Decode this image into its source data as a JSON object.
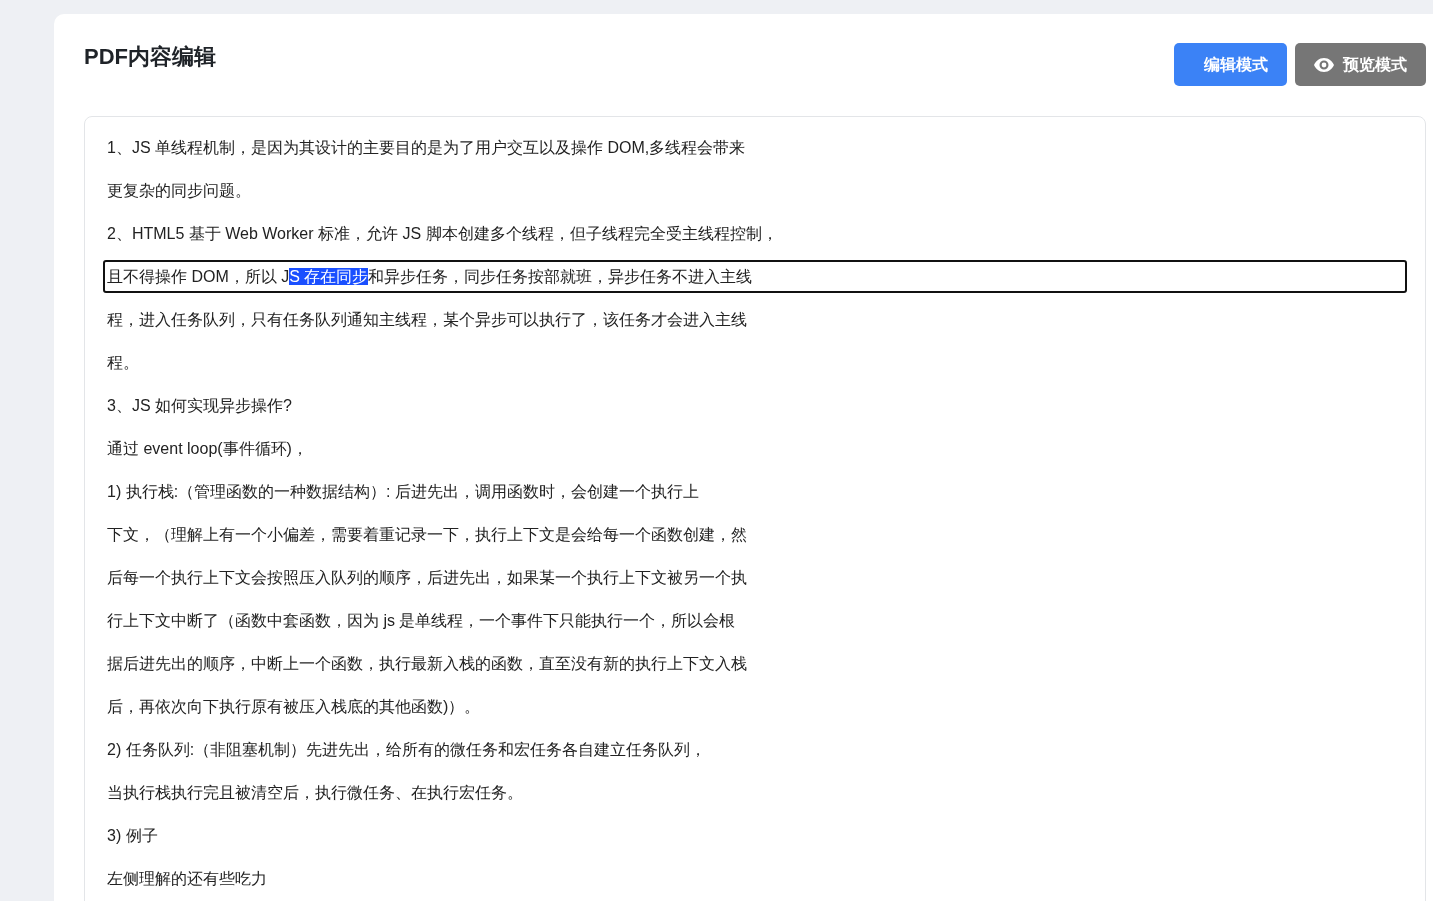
{
  "title": "PDF内容编辑",
  "modes": [
    {
      "label": "编辑模式",
      "kind": "edit",
      "selected": true
    },
    {
      "label": "预览模式",
      "kind": "preview",
      "selected": false
    }
  ],
  "lines": [
    {
      "focused": false,
      "segments": [
        {
          "text": "1、JS 单线程机制，是因为其设计的主要目的是为了用户交互以及操作 DOM,多线程会带来",
          "selected": false
        }
      ]
    },
    {
      "focused": false,
      "segments": [
        {
          "text": "更复杂的同步问题。",
          "selected": false
        }
      ]
    },
    {
      "focused": false,
      "segments": [
        {
          "text": "2、HTML5 基于 Web Worker 标准，允许 JS 脚本创建多个线程，但子线程完全受主线程控制，",
          "selected": false
        }
      ]
    },
    {
      "focused": true,
      "segments": [
        {
          "text": "且不得操作 DOM，所以 J",
          "selected": false
        },
        {
          "text": "S 存在同步",
          "selected": true
        },
        {
          "text": "和异步任务，同步任务按部就班，异步任务不进入主线",
          "selected": false
        }
      ]
    },
    {
      "focused": false,
      "segments": [
        {
          "text": "程，进入任务队列，只有任务队列通知主线程，某个异步可以执行了，该任务才会进入主线",
          "selected": false
        }
      ]
    },
    {
      "focused": false,
      "segments": [
        {
          "text": "程。",
          "selected": false
        }
      ]
    },
    {
      "focused": false,
      "segments": [
        {
          "text": "3、JS 如何实现异步操作?",
          "selected": false
        }
      ]
    },
    {
      "focused": false,
      "segments": [
        {
          "text": "通过 event loop(事件循环)，",
          "selected": false
        }
      ]
    },
    {
      "focused": false,
      "segments": [
        {
          "text": "1) 执行栈:（管理函数的一种数据结构）: 后进先出，调用函数时，会创建一个执行上",
          "selected": false
        }
      ]
    },
    {
      "focused": false,
      "segments": [
        {
          "text": "下文，（理解上有一个小偏差，需要着重记录一下，执行上下文是会给每一个函数创建，然",
          "selected": false
        }
      ]
    },
    {
      "focused": false,
      "segments": [
        {
          "text": "后每一个执行上下文会按照压入队列的顺序，后进先出，如果某一个执行上下文被另一个执",
          "selected": false
        }
      ]
    },
    {
      "focused": false,
      "segments": [
        {
          "text": "行上下文中断了（函数中套函数，因为 js 是单线程，一个事件下只能执行一个，所以会根",
          "selected": false
        }
      ]
    },
    {
      "focused": false,
      "segments": [
        {
          "text": "据后进先出的顺序，中断上一个函数，执行最新入栈的函数，直至没有新的执行上下文入栈",
          "selected": false
        }
      ]
    },
    {
      "focused": false,
      "segments": [
        {
          "text": "后，再依次向下执行原有被压入栈底的其他函数)）。",
          "selected": false
        }
      ]
    },
    {
      "focused": false,
      "segments": [
        {
          "text": "2) 任务队列:（非阻塞机制）先进先出，给所有的微任务和宏任务各自建立任务队列，",
          "selected": false
        }
      ]
    },
    {
      "focused": false,
      "segments": [
        {
          "text": "当执行栈执行完且被清空后，执行微任务、在执行宏任务。",
          "selected": false
        }
      ]
    },
    {
      "focused": false,
      "segments": [
        {
          "text": "3) 例子",
          "selected": false
        }
      ]
    },
    {
      "focused": false,
      "segments": [
        {
          "text": "左侧理解的还有些吃力",
          "selected": false
        }
      ]
    }
  ]
}
